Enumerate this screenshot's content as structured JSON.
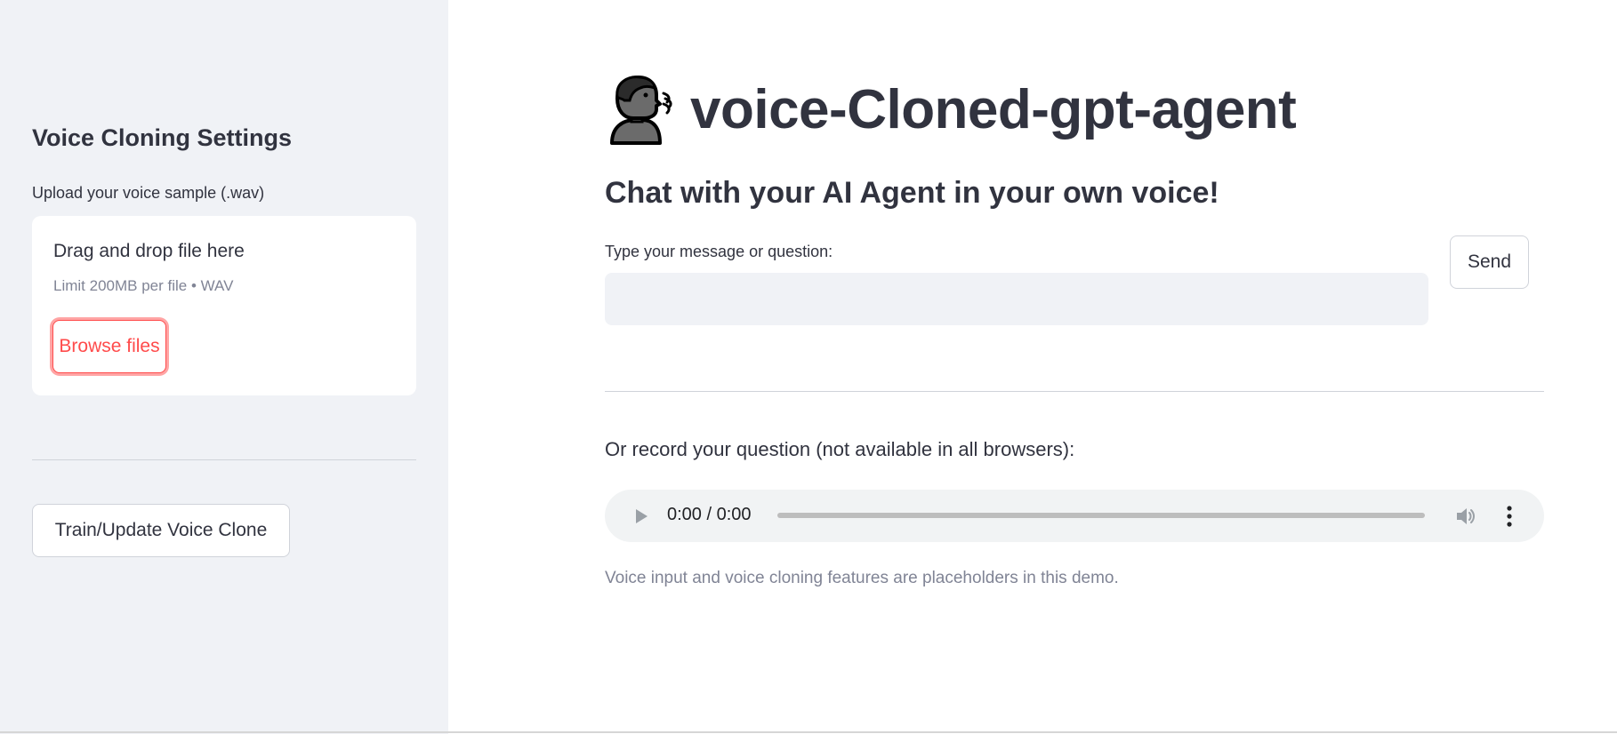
{
  "sidebar": {
    "title": "Voice Cloning Settings",
    "upload_label": "Upload your voice sample (.wav)",
    "dropzone": {
      "title": "Drag and drop file here",
      "limit": "Limit 200MB per file • WAV",
      "browse_label": "Browse files"
    },
    "train_button_label": "Train/Update Voice Clone"
  },
  "main": {
    "title_emoji": "speaking-head-icon",
    "title": "voice-Cloned-gpt-agent",
    "subtitle": "Chat with your AI Agent in your own voice!",
    "input_label": "Type your message or question:",
    "input_value": "",
    "send_label": "Send",
    "record_label": "Or record your question (not available in all browsers):",
    "audio": {
      "time": "0:00 / 0:00",
      "progress": 0
    },
    "caption": "Voice input and voice cloning features are placeholders in this demo."
  },
  "colors": {
    "sidebar_bg": "#f0f2f6",
    "accent": "#ff4b4b",
    "text": "#31333f",
    "muted_text": "#808495"
  }
}
